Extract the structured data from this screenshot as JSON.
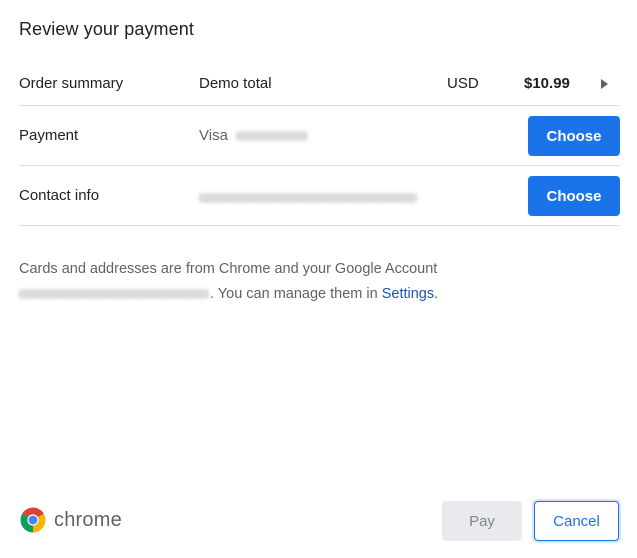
{
  "dialog": {
    "title": "Review your payment"
  },
  "order_summary": {
    "label": "Order summary",
    "item": "Demo total",
    "currency": "USD",
    "amount": "$10.99"
  },
  "payment": {
    "label": "Payment",
    "card_brand": "Visa",
    "button_label": "Choose"
  },
  "contact": {
    "label": "Contact info",
    "button_label": "Choose"
  },
  "info": {
    "line1": "Cards and addresses are from Chrome and your Google Account",
    "line2_text": ". You can manage them in ",
    "settings_link": "Settings",
    "line2_end": "."
  },
  "footer": {
    "brand": "chrome",
    "pay_label": "Pay",
    "cancel_label": "Cancel"
  },
  "colors": {
    "accent": "#1a73e8",
    "divider": "#dadce0",
    "secondary_text": "#5f6368"
  },
  "icons": {
    "expand": "triangle-right",
    "brand_logo": "chrome-logo"
  }
}
